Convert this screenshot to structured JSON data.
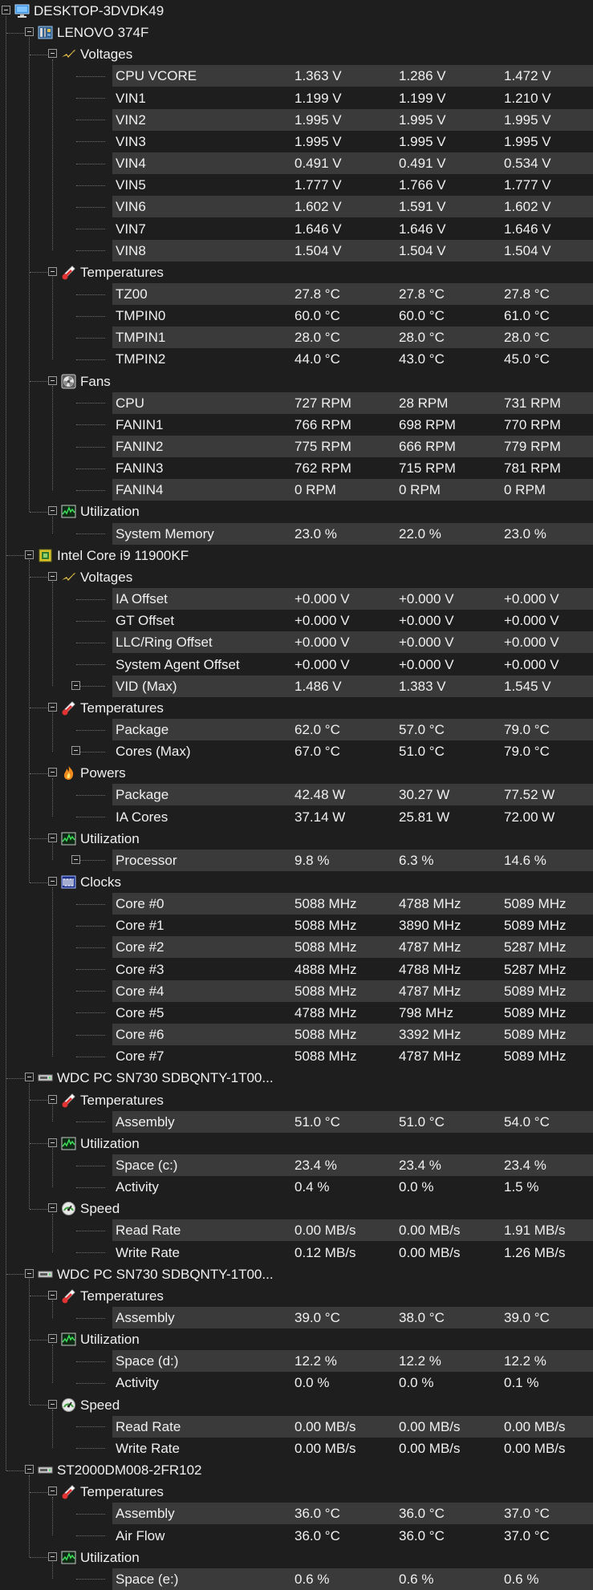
{
  "tree": [
    {
      "type": "node",
      "level": 0,
      "label": "DESKTOP-3DVDK49",
      "icon": "computer-icon"
    },
    {
      "type": "node",
      "level": 1,
      "label": "LENOVO 374F",
      "icon": "motherboard-icon"
    },
    {
      "type": "node",
      "level": 2,
      "label": "Voltages",
      "icon": "voltage-icon"
    },
    {
      "type": "sensor",
      "label": "CPU VCORE",
      "values": [
        "1.363 V",
        "1.286 V",
        "1.472 V"
      ]
    },
    {
      "type": "sensor",
      "label": "VIN1",
      "values": [
        "1.199 V",
        "1.199 V",
        "1.210 V"
      ]
    },
    {
      "type": "sensor",
      "label": "VIN2",
      "values": [
        "1.995 V",
        "1.995 V",
        "1.995 V"
      ]
    },
    {
      "type": "sensor",
      "label": "VIN3",
      "values": [
        "1.995 V",
        "1.995 V",
        "1.995 V"
      ]
    },
    {
      "type": "sensor",
      "label": "VIN4",
      "values": [
        "0.491 V",
        "0.491 V",
        "0.534 V"
      ]
    },
    {
      "type": "sensor",
      "label": "VIN5",
      "values": [
        "1.777 V",
        "1.766 V",
        "1.777 V"
      ]
    },
    {
      "type": "sensor",
      "label": "VIN6",
      "values": [
        "1.602 V",
        "1.591 V",
        "1.602 V"
      ]
    },
    {
      "type": "sensor",
      "label": "VIN7",
      "values": [
        "1.646 V",
        "1.646 V",
        "1.646 V"
      ]
    },
    {
      "type": "sensor",
      "label": "VIN8",
      "values": [
        "1.504 V",
        "1.504 V",
        "1.504 V"
      ]
    },
    {
      "type": "node",
      "level": 2,
      "label": "Temperatures",
      "icon": "thermometer-icon"
    },
    {
      "type": "sensor",
      "label": "TZ00",
      "values": [
        "27.8 °C",
        "27.8 °C",
        "27.8 °C"
      ]
    },
    {
      "type": "sensor",
      "label": "TMPIN0",
      "values": [
        "60.0 °C",
        "60.0 °C",
        "61.0 °C"
      ]
    },
    {
      "type": "sensor",
      "label": "TMPIN1",
      "values": [
        "28.0 °C",
        "28.0 °C",
        "28.0 °C"
      ]
    },
    {
      "type": "sensor",
      "label": "TMPIN2",
      "values": [
        "44.0 °C",
        "43.0 °C",
        "45.0 °C"
      ]
    },
    {
      "type": "node",
      "level": 2,
      "label": "Fans",
      "icon": "fan-icon"
    },
    {
      "type": "sensor",
      "label": "CPU",
      "values": [
        "727 RPM",
        "28 RPM",
        "731 RPM"
      ]
    },
    {
      "type": "sensor",
      "label": "FANIN1",
      "values": [
        "766 RPM",
        "698 RPM",
        "770 RPM"
      ]
    },
    {
      "type": "sensor",
      "label": "FANIN2",
      "values": [
        "775 RPM",
        "666 RPM",
        "779 RPM"
      ]
    },
    {
      "type": "sensor",
      "label": "FANIN3",
      "values": [
        "762 RPM",
        "715 RPM",
        "781 RPM"
      ]
    },
    {
      "type": "sensor",
      "label": "FANIN4",
      "values": [
        "0 RPM",
        "0 RPM",
        "0 RPM"
      ]
    },
    {
      "type": "node",
      "level": 2,
      "label": "Utilization",
      "icon": "utilization-icon"
    },
    {
      "type": "sensor",
      "label": "System Memory",
      "values": [
        "23.0 %",
        "22.0 %",
        "23.0 %"
      ]
    },
    {
      "type": "node",
      "level": 1,
      "label": "Intel Core i9 11900KF",
      "icon": "cpu-chip-icon"
    },
    {
      "type": "node",
      "level": 2,
      "label": "Voltages",
      "icon": "voltage-icon"
    },
    {
      "type": "sensor",
      "label": "IA Offset",
      "values": [
        "+0.000 V",
        "+0.000 V",
        "+0.000 V"
      ]
    },
    {
      "type": "sensor",
      "label": "GT Offset",
      "values": [
        "+0.000 V",
        "+0.000 V",
        "+0.000 V"
      ]
    },
    {
      "type": "sensor",
      "label": "LLC/Ring Offset",
      "values": [
        "+0.000 V",
        "+0.000 V",
        "+0.000 V"
      ]
    },
    {
      "type": "sensor",
      "label": "System Agent Offset",
      "values": [
        "+0.000 V",
        "+0.000 V",
        "+0.000 V"
      ]
    },
    {
      "type": "sensor",
      "label": "VID (Max)",
      "values": [
        "1.486 V",
        "1.383 V",
        "1.545 V"
      ],
      "expander": true
    },
    {
      "type": "node",
      "level": 2,
      "label": "Temperatures",
      "icon": "thermometer-icon"
    },
    {
      "type": "sensor",
      "label": "Package",
      "values": [
        "62.0 °C",
        "57.0 °C",
        "79.0 °C"
      ]
    },
    {
      "type": "sensor",
      "label": "Cores (Max)",
      "values": [
        "67.0 °C",
        "51.0 °C",
        "79.0 °C"
      ],
      "expander": true
    },
    {
      "type": "node",
      "level": 2,
      "label": "Powers",
      "icon": "power-flame-icon"
    },
    {
      "type": "sensor",
      "label": "Package",
      "values": [
        "42.48 W",
        "30.27 W",
        "77.52 W"
      ]
    },
    {
      "type": "sensor",
      "label": "IA Cores",
      "values": [
        "37.14 W",
        "25.81 W",
        "72.00 W"
      ]
    },
    {
      "type": "node",
      "level": 2,
      "label": "Utilization",
      "icon": "utilization-icon"
    },
    {
      "type": "sensor",
      "label": "Processor",
      "values": [
        "9.8 %",
        "6.3 %",
        "14.6 %"
      ],
      "expander": true
    },
    {
      "type": "node",
      "level": 2,
      "label": "Clocks",
      "icon": "clock-icon"
    },
    {
      "type": "sensor",
      "label": "Core #0",
      "values": [
        "5088 MHz",
        "4788 MHz",
        "5089 MHz"
      ]
    },
    {
      "type": "sensor",
      "label": "Core #1",
      "values": [
        "5088 MHz",
        "3890 MHz",
        "5089 MHz"
      ]
    },
    {
      "type": "sensor",
      "label": "Core #2",
      "values": [
        "5088 MHz",
        "4787 MHz",
        "5287 MHz"
      ]
    },
    {
      "type": "sensor",
      "label": "Core #3",
      "values": [
        "4888 MHz",
        "4788 MHz",
        "5287 MHz"
      ]
    },
    {
      "type": "sensor",
      "label": "Core #4",
      "values": [
        "5088 MHz",
        "4787 MHz",
        "5089 MHz"
      ]
    },
    {
      "type": "sensor",
      "label": "Core #5",
      "values": [
        "4788 MHz",
        "798 MHz",
        "5089 MHz"
      ]
    },
    {
      "type": "sensor",
      "label": "Core #6",
      "values": [
        "5088 MHz",
        "3392 MHz",
        "5089 MHz"
      ]
    },
    {
      "type": "sensor",
      "label": "Core #7",
      "values": [
        "5088 MHz",
        "4787 MHz",
        "5089 MHz"
      ]
    },
    {
      "type": "node",
      "level": 1,
      "label": "WDC PC SN730 SDBQNTY-1T00...",
      "icon": "drive-icon"
    },
    {
      "type": "node",
      "level": 2,
      "label": "Temperatures",
      "icon": "thermometer-icon"
    },
    {
      "type": "sensor",
      "label": "Assembly",
      "values": [
        "51.0 °C",
        "51.0 °C",
        "54.0 °C"
      ]
    },
    {
      "type": "node",
      "level": 2,
      "label": "Utilization",
      "icon": "utilization-icon"
    },
    {
      "type": "sensor",
      "label": "Space (c:)",
      "values": [
        "23.4 %",
        "23.4 %",
        "23.4 %"
      ]
    },
    {
      "type": "sensor",
      "label": "Activity",
      "values": [
        "0.4 %",
        "0.0 %",
        "1.5 %"
      ]
    },
    {
      "type": "node",
      "level": 2,
      "label": "Speed",
      "icon": "speedometer-icon"
    },
    {
      "type": "sensor",
      "label": "Read Rate",
      "values": [
        "0.00 MB/s",
        "0.00 MB/s",
        "1.91 MB/s"
      ]
    },
    {
      "type": "sensor",
      "label": "Write Rate",
      "values": [
        "0.12 MB/s",
        "0.00 MB/s",
        "1.26 MB/s"
      ]
    },
    {
      "type": "node",
      "level": 1,
      "label": "WDC PC SN730 SDBQNTY-1T00...",
      "icon": "drive-icon"
    },
    {
      "type": "node",
      "level": 2,
      "label": "Temperatures",
      "icon": "thermometer-icon"
    },
    {
      "type": "sensor",
      "label": "Assembly",
      "values": [
        "39.0 °C",
        "38.0 °C",
        "39.0 °C"
      ]
    },
    {
      "type": "node",
      "level": 2,
      "label": "Utilization",
      "icon": "utilization-icon"
    },
    {
      "type": "sensor",
      "label": "Space (d:)",
      "values": [
        "12.2 %",
        "12.2 %",
        "12.2 %"
      ]
    },
    {
      "type": "sensor",
      "label": "Activity",
      "values": [
        "0.0 %",
        "0.0 %",
        "0.1 %"
      ]
    },
    {
      "type": "node",
      "level": 2,
      "label": "Speed",
      "icon": "speedometer-icon"
    },
    {
      "type": "sensor",
      "label": "Read Rate",
      "values": [
        "0.00 MB/s",
        "0.00 MB/s",
        "0.00 MB/s"
      ]
    },
    {
      "type": "sensor",
      "label": "Write Rate",
      "values": [
        "0.00 MB/s",
        "0.00 MB/s",
        "0.00 MB/s"
      ]
    },
    {
      "type": "node",
      "level": 1,
      "label": "ST2000DM008-2FR102",
      "icon": "drive-icon"
    },
    {
      "type": "node",
      "level": 2,
      "label": "Temperatures",
      "icon": "thermometer-icon"
    },
    {
      "type": "sensor",
      "label": "Assembly",
      "values": [
        "36.0 °C",
        "36.0 °C",
        "37.0 °C"
      ]
    },
    {
      "type": "sensor",
      "label": "Air Flow",
      "values": [
        "36.0 °C",
        "36.0 °C",
        "37.0 °C"
      ]
    },
    {
      "type": "node",
      "level": 2,
      "label": "Utilization",
      "icon": "utilization-icon"
    },
    {
      "type": "sensor",
      "label": "Space (e:)",
      "values": [
        "0.6 %",
        "0.6 %",
        "0.6 %"
      ]
    }
  ]
}
